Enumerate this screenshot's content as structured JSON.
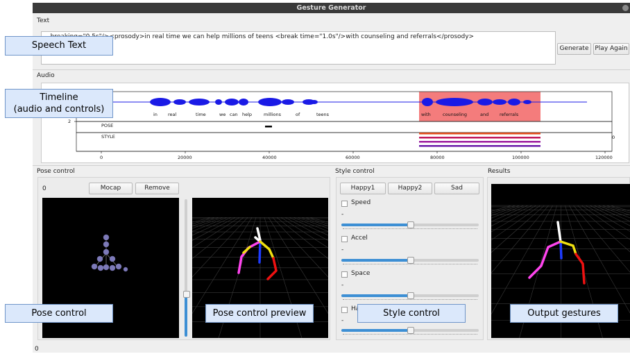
{
  "window": {
    "title": "Gesture Generator"
  },
  "sections": {
    "text": "Text",
    "audio": "Audio",
    "pose_control": "Pose control",
    "style_control": "Style control",
    "results": "Results"
  },
  "text_input": {
    "value": "...breaking=\"0.5s\"/><prosody>in real time we can help millions of teens <break time=\"1.0s\"/>with counseling and referrals</prosody>"
  },
  "buttons": {
    "generate": "Generate",
    "play_again": "Play Again",
    "mocap": "Mocap",
    "remove": "Remove",
    "happy1": "Happy1",
    "happy2": "Happy2",
    "sad": "Sad"
  },
  "timeline": {
    "words": [
      "in",
      "real",
      "time",
      "we",
      "can",
      "help",
      "millions",
      "of",
      "teens",
      "with",
      "counseling",
      "and",
      "referrals"
    ],
    "tracks": [
      "POSE",
      "STYLE"
    ],
    "axis_ticks": [
      "0",
      "20000",
      "40000",
      "60000",
      "80000",
      "100000",
      "120000"
    ],
    "left_tick_2": "2",
    "right_tick": "0",
    "highlight_color": "#f47c7c",
    "waveform_color": "#1a1ae6"
  },
  "pose_control": {
    "frame_value": "0"
  },
  "style_control": {
    "params": [
      {
        "label": "Speed",
        "dash": "-",
        "value": 0.5
      },
      {
        "label": "Accel",
        "dash": "-",
        "value": 0.5
      },
      {
        "label": "Space",
        "dash": "-",
        "value": 0.5
      },
      {
        "label": "Ha",
        "dash": "-",
        "value": 0.5
      }
    ]
  },
  "status": {
    "value": "0"
  },
  "callouts": {
    "speech_text": "Speech Text",
    "timeline_line1": "Timeline",
    "timeline_line2": "(audio and controls)",
    "pose_control": "Pose control",
    "pose_preview": "Pose control preview",
    "style_control": "Style control",
    "output_gestures": "Output gestures"
  }
}
